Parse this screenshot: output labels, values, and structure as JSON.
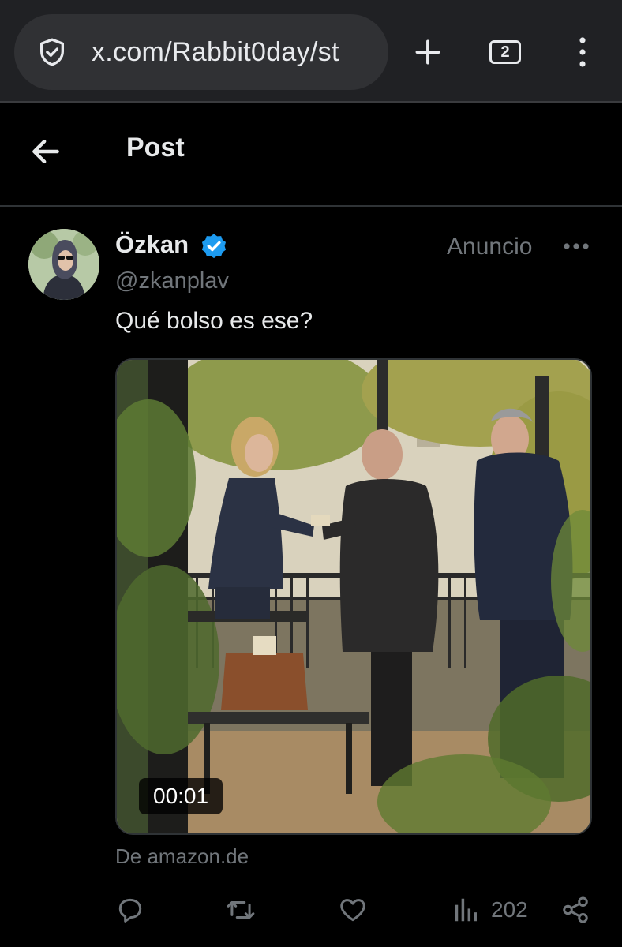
{
  "browser": {
    "url": "x.com/Rabbit0day/st",
    "tab_count": "2",
    "icons": {
      "security": "shield-check-icon",
      "new_tab": "plus-icon",
      "tabs": "tab-switcher-icon",
      "menu": "vertical-dots-icon"
    }
  },
  "header": {
    "title": "Post",
    "back_icon": "arrow-left-icon"
  },
  "post": {
    "author_name": "Özkan",
    "verified": true,
    "handle": "@zkanplav",
    "ad_label": "Anuncio",
    "text": "Qué bolso es ese?",
    "media": {
      "type": "video",
      "duration": "00:01"
    },
    "source": "De amazon.de",
    "actions": {
      "views": "202",
      "icons": [
        "reply-icon",
        "repost-icon",
        "like-icon",
        "views-icon",
        "share-icon"
      ]
    }
  },
  "colors": {
    "background": "#000000",
    "chrome": "#202124",
    "verified_blue": "#1d9bf0",
    "muted_text": "#71767b"
  }
}
